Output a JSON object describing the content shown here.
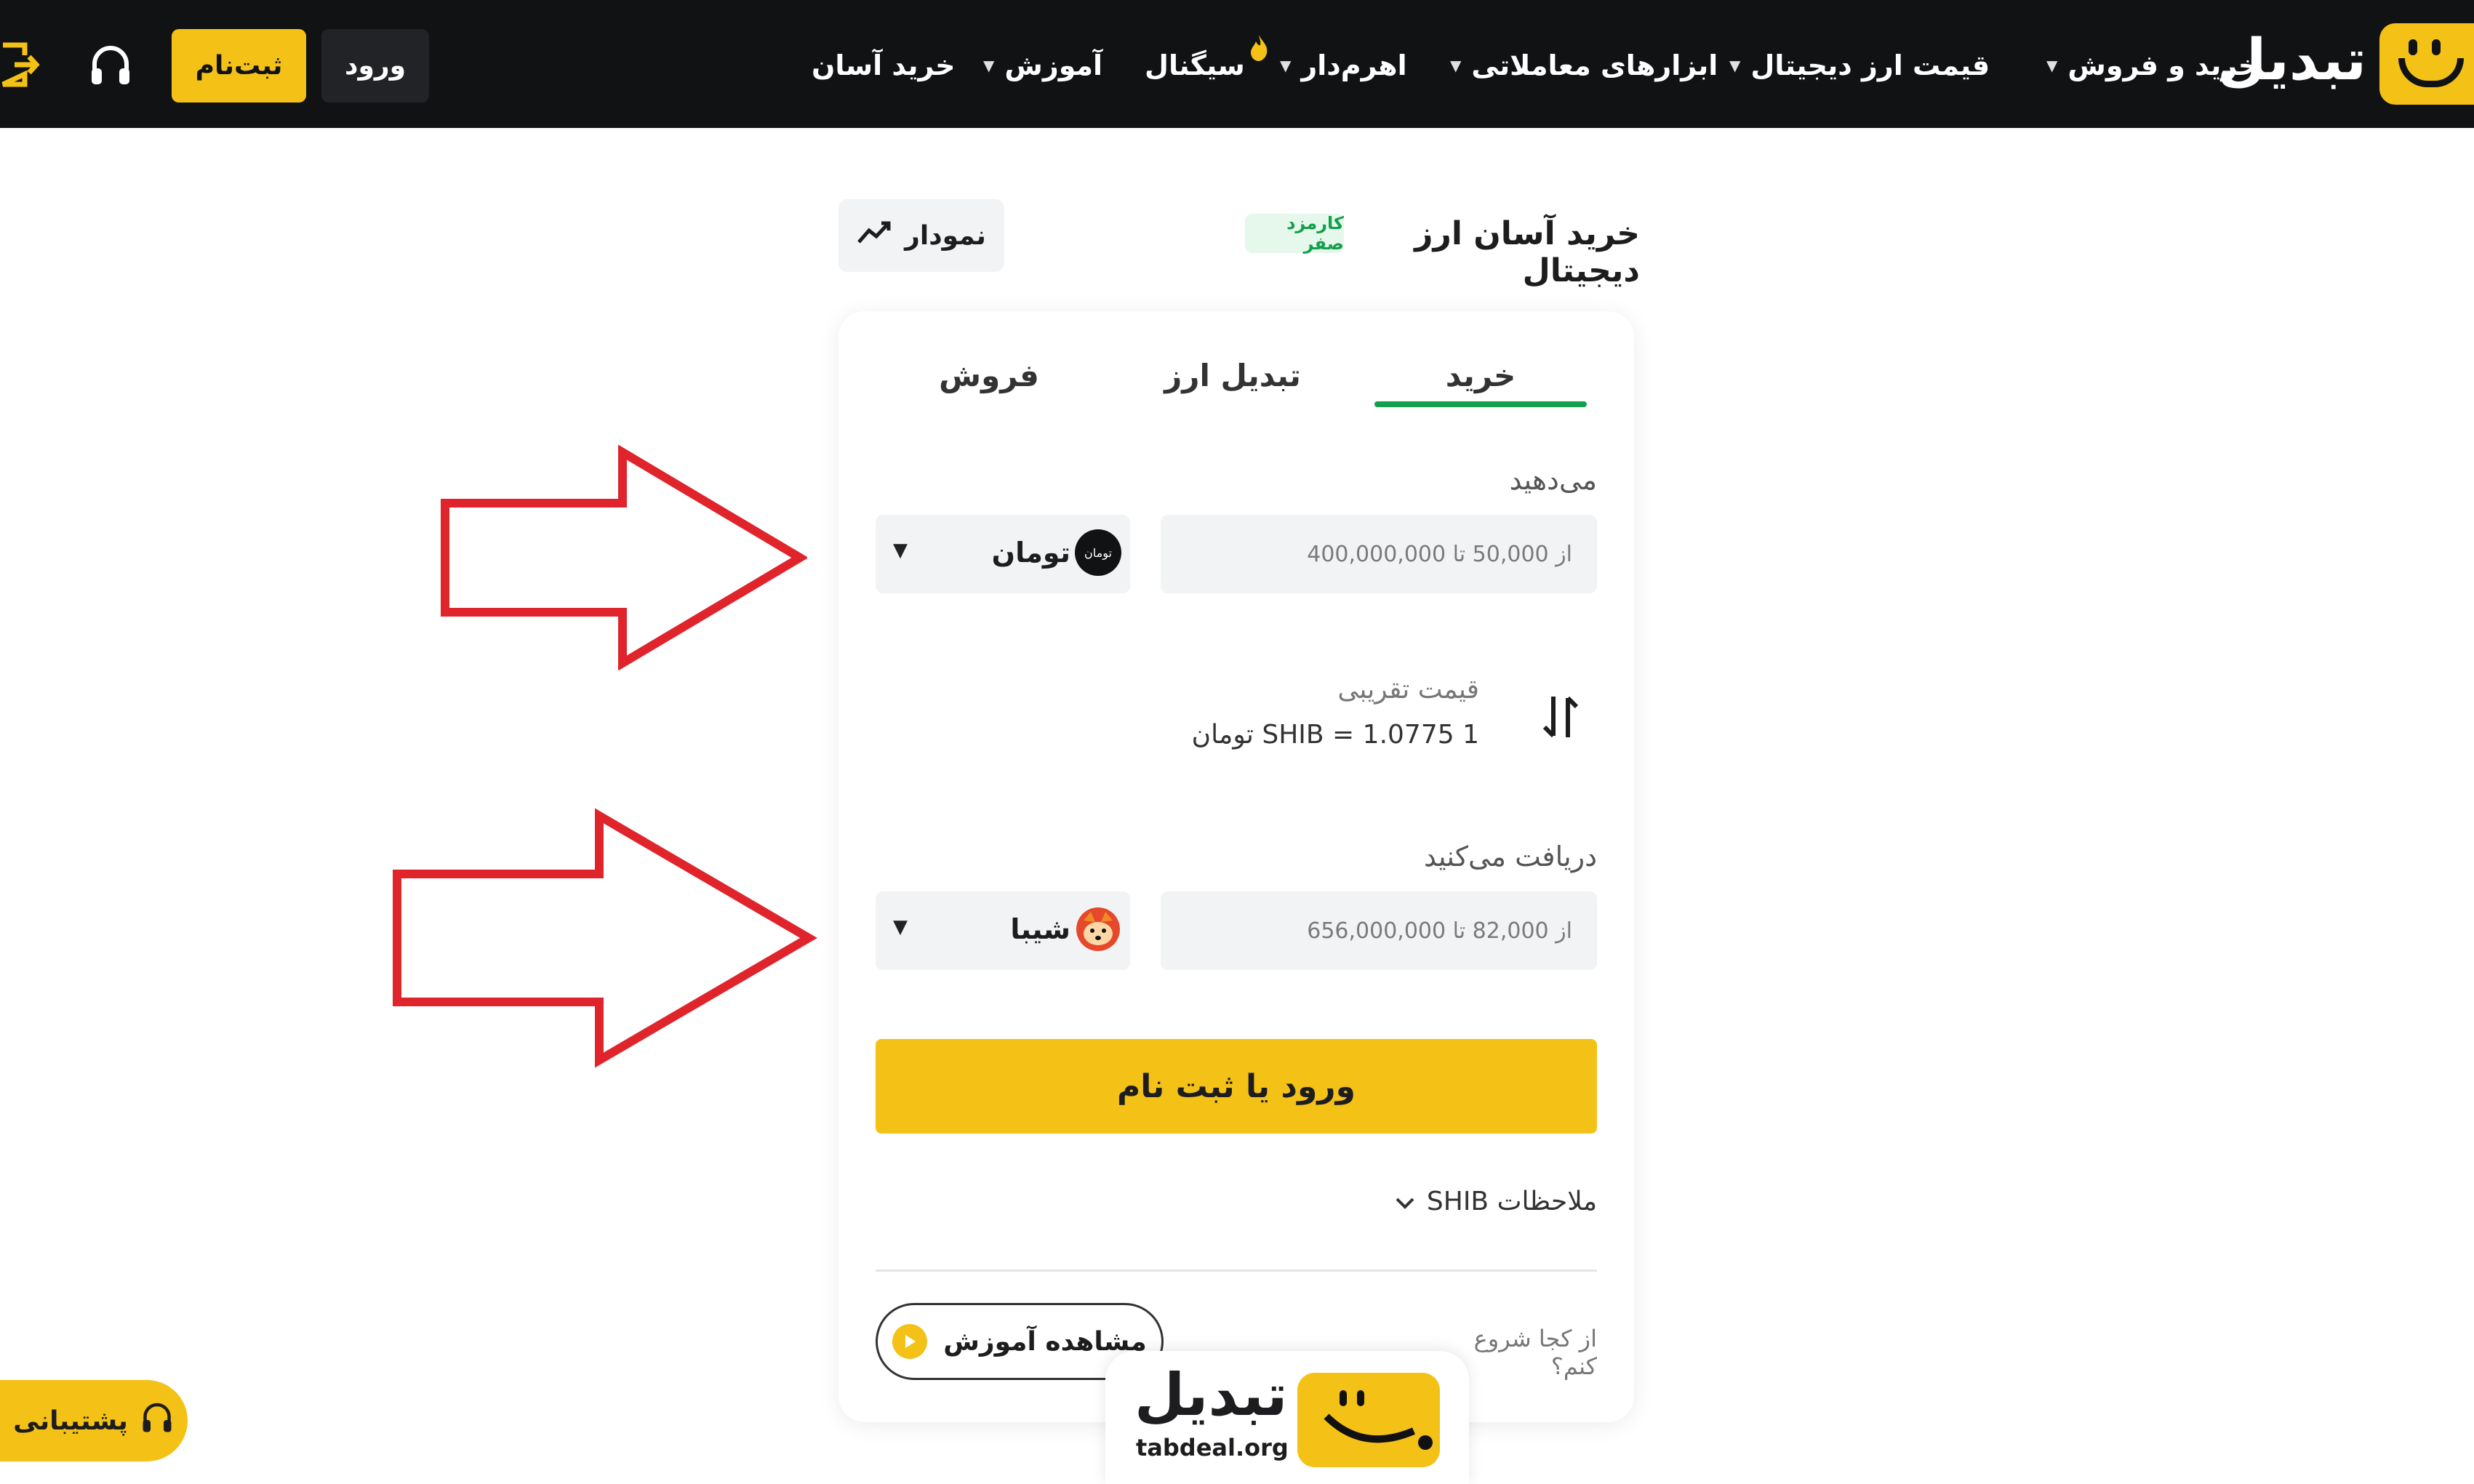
{
  "header": {
    "logo_text": "تبدیل",
    "nav": [
      {
        "label": "خرید و فروش",
        "has_caret": true
      },
      {
        "label": "قیمت ارز دیجیتال",
        "has_caret": true
      },
      {
        "label": "ابزارهای معاملاتی",
        "has_caret": true
      },
      {
        "label": "اهرم‌دار",
        "has_caret": true
      },
      {
        "label": "سیگنال",
        "has_caret": false
      },
      {
        "label": "آموزش",
        "has_caret": true
      },
      {
        "label": "خرید آسان",
        "has_caret": false
      }
    ],
    "signup_label": "ثبت‌نام",
    "login_label": "ورود",
    "icons": [
      "support-headset-icon",
      "exit-icon",
      "fire-icon"
    ]
  },
  "page": {
    "title": "خرید آسان ارز دیجیتال",
    "fee_badge": "کارمزد صفر",
    "chart_button": "نمودار"
  },
  "trade": {
    "tabs": [
      {
        "label": "خرید",
        "active": true
      },
      {
        "label": "تبدیل ارز",
        "active": false
      },
      {
        "label": "فروش",
        "active": false
      }
    ],
    "give": {
      "label": "می‌دهید",
      "placeholder": "از 50,000 تا 400,000,000",
      "currency": "تومان",
      "coin_text": "تومان"
    },
    "price": {
      "label": "قیمت تقریبی",
      "value": "1 SHIB = 1.0775 تومان"
    },
    "receive": {
      "label": "دریافت می‌کنید",
      "placeholder": "از 82,000 تا 656,000,000",
      "currency": "شیبا"
    },
    "cta_label": "ورود یا ثبت نام",
    "notes_label": "ملاحظات SHIB",
    "where_start": "از کجا شروع کنم؟",
    "tutorial_label": "مشاهده آموزش"
  },
  "support": {
    "label": "پشتیبانی"
  },
  "watermark": {
    "name": "تبدیل",
    "domain": "tabdeal.org"
  },
  "colors": {
    "brand_yellow": "#f4c117",
    "dark": "#111214",
    "green": "#11a14b",
    "arrow_red": "#e0242c"
  }
}
